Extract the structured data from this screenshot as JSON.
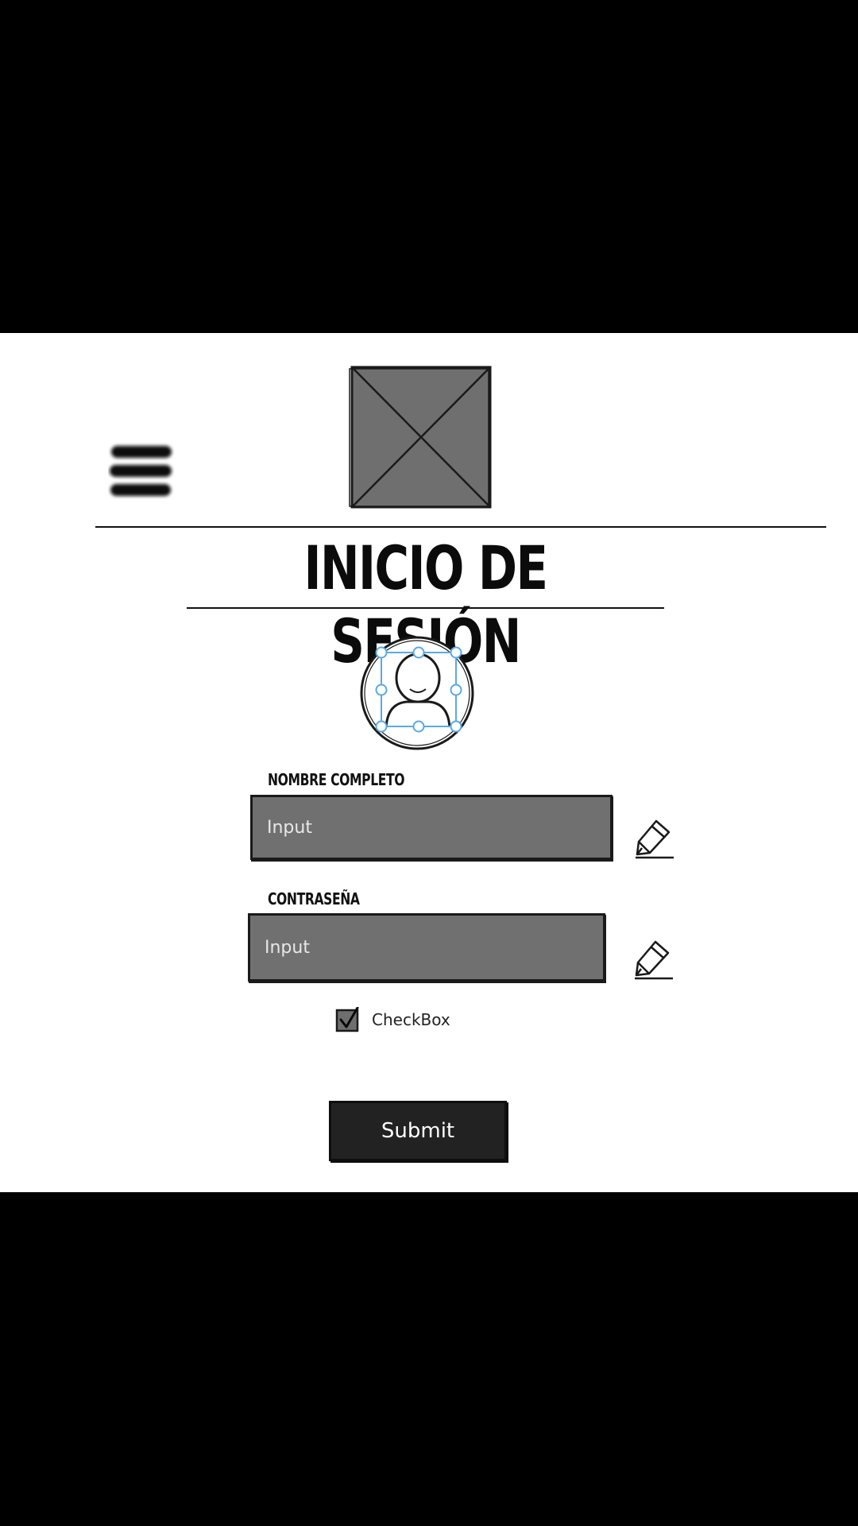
{
  "header": {
    "menu_icon": "hamburger-menu-icon",
    "logo_icon": "image-placeholder-icon"
  },
  "title": "INICIO DE SESIÓN",
  "avatar_icon": "user-avatar-icon",
  "form": {
    "name_label": "NOMBRE COMPLETO",
    "name_value": "Input",
    "password_label": "CONTRASEÑA",
    "password_value": "Input",
    "edit_icon": "pencil-icon",
    "checkbox_label": "CheckBox",
    "checkbox_checked": true,
    "submit_label": "Submit"
  },
  "colors": {
    "background": "#000000",
    "canvas": "#ffffff",
    "input_fill": "#707070",
    "button_fill": "#222222",
    "selection_handles": "#5aa9e6"
  }
}
